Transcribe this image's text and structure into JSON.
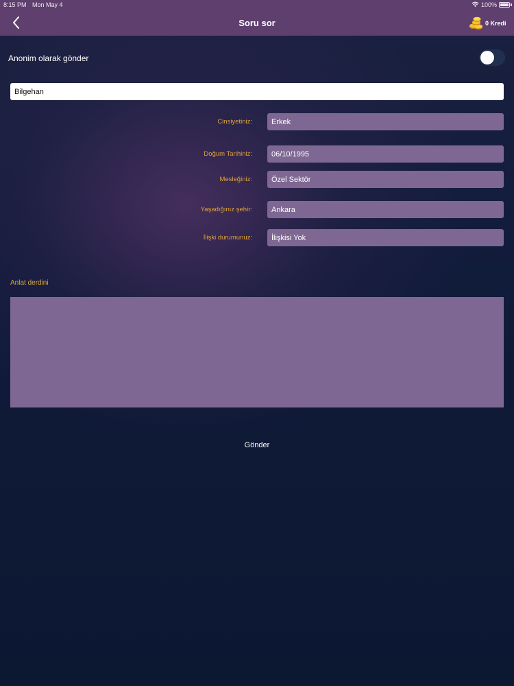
{
  "status_bar": {
    "time": "8:15 PM",
    "date": "Mon May 4",
    "battery": "100%"
  },
  "nav": {
    "title": "Soru sor",
    "credits": "0 Kredi"
  },
  "anonymous": {
    "label": "Anonim olarak gönder",
    "enabled": false
  },
  "name_field": {
    "value": "Bilgehan"
  },
  "fields": [
    {
      "label": "Cinsiyetiniz:",
      "value": "Erkek"
    },
    {
      "label": "Doğum Tarihiniz:",
      "value": "06/10/1995"
    },
    {
      "label": "Mesleğiniz:",
      "value": "Özel Sektör"
    },
    {
      "label": "Yaşadığınız şehir:",
      "value": "Ankara"
    },
    {
      "label": "İlişki durumunuz:",
      "value": "İlişkisi Yok"
    }
  ],
  "message": {
    "label": "Anlat derdini",
    "value": ""
  },
  "submit_label": "Gönder",
  "colors": {
    "nav_bg": "#5e3f6e",
    "accent_label": "#e0a43a",
    "field_bg": "#7e6893",
    "page_bg": "#0e1a36"
  }
}
